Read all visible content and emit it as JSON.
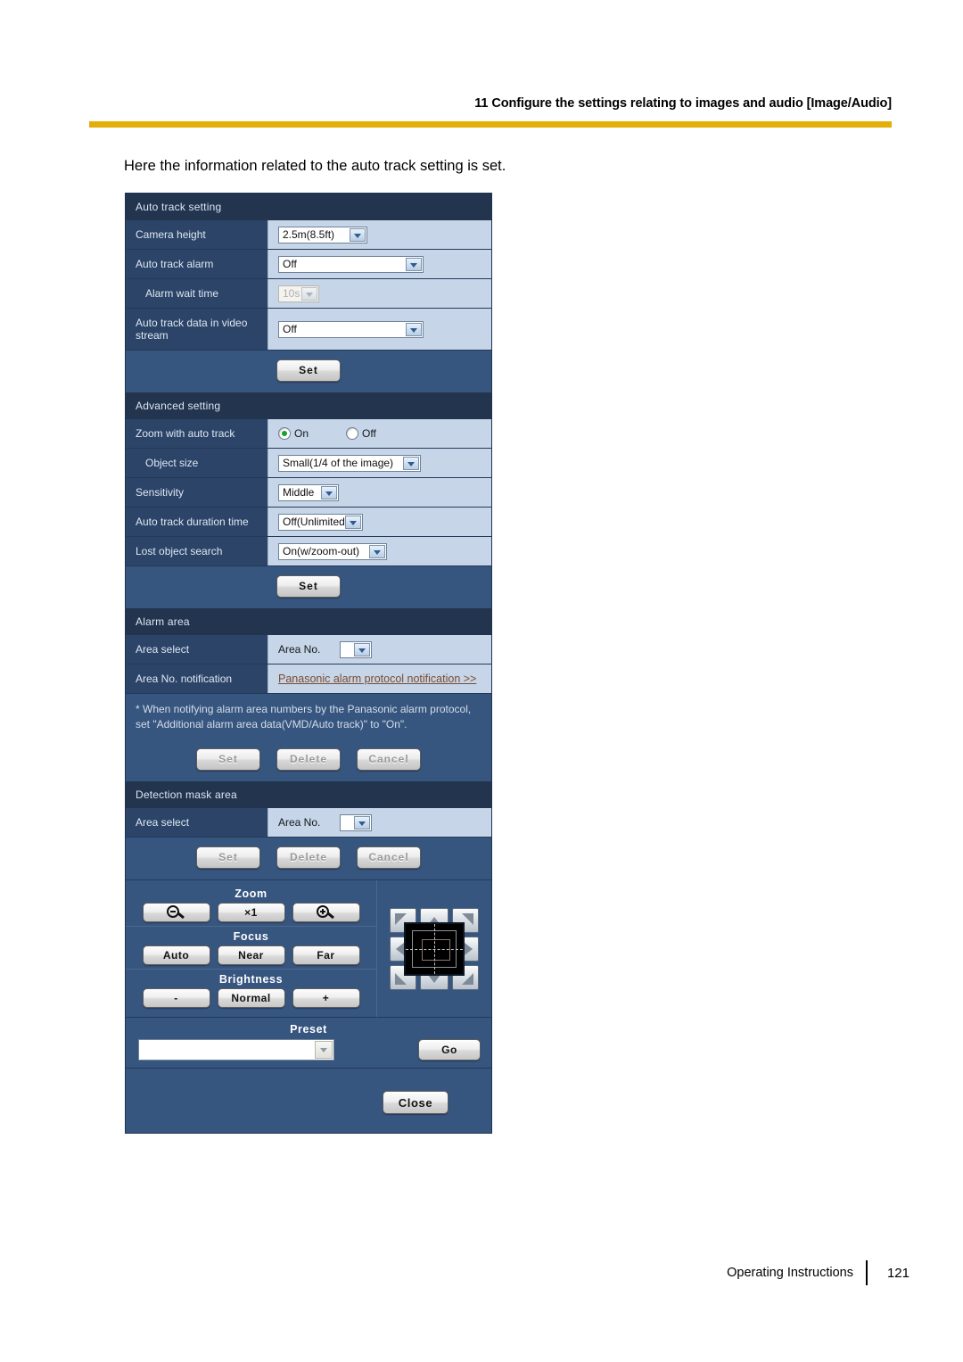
{
  "page": {
    "header_title": "11 Configure the settings relating to images and audio [Image/Audio]",
    "intro_text": "Here the information related to the auto track setting is set.",
    "rule_color": "#e3ae09"
  },
  "footer": {
    "label": "Operating Instructions",
    "page_number": "121"
  },
  "panel": {
    "auto_track_setting": {
      "section_title": "Auto track setting",
      "rows": [
        {
          "label": "Camera height",
          "value": "2.5m(8.5ft)"
        },
        {
          "label": "Auto track alarm",
          "value": "Off"
        },
        {
          "label": "Alarm wait time",
          "value": "10s"
        },
        {
          "label": "Auto track data in video stream",
          "value": "Off"
        }
      ],
      "set_label": "Set"
    },
    "advanced_setting": {
      "section_title": "Advanced setting",
      "zoom_with_auto_track": {
        "label": "Zoom with auto track",
        "on_label": "On",
        "off_label": "Off",
        "selected": "On"
      },
      "rows": [
        {
          "label": "Object size",
          "value": "Small(1/4 of the image)"
        },
        {
          "label": "Sensitivity",
          "value": "Middle"
        },
        {
          "label": "Auto track duration time",
          "value": "Off(Unlimited)"
        },
        {
          "label": "Lost object search",
          "value": "On(w/zoom-out)"
        }
      ],
      "set_label": "Set"
    },
    "alarm_area": {
      "section_title": "Alarm area",
      "area_select_label": "Area select",
      "area_no_label": "Area No.",
      "area_no_value": "",
      "notification_label": "Area No. notification",
      "notification_link": "Panasonic alarm protocol notification >>",
      "note_line1": "* When notifying alarm area numbers by the Panasonic alarm protocol,",
      "note_line2": "set \"Additional alarm area data(VMD/Auto track)\" to \"On\".",
      "buttons": [
        {
          "label": "Set",
          "disabled": true
        },
        {
          "label": "Delete",
          "disabled": true
        },
        {
          "label": "Cancel",
          "disabled": true
        }
      ]
    },
    "detection_mask_area": {
      "section_title": "Detection mask area",
      "area_select_label": "Area select",
      "area_no_label": "Area No.",
      "area_no_value": "",
      "buttons": [
        {
          "label": "Set",
          "disabled": true
        },
        {
          "label": "Delete",
          "disabled": true
        },
        {
          "label": "Cancel",
          "disabled": true
        }
      ]
    },
    "ptz": {
      "zoom": {
        "title": "Zoom",
        "out_icon": "zoom-out-icon",
        "reset_label": "×1",
        "in_icon": "zoom-in-icon"
      },
      "focus": {
        "title": "Focus",
        "auto_label": "Auto",
        "near_label": "Near",
        "far_label": "Far"
      },
      "brightness": {
        "title": "Brightness",
        "minus_label": "-",
        "normal_label": "Normal",
        "plus_label": "+"
      }
    },
    "preset": {
      "title": "Preset",
      "value": "",
      "go_label": "Go"
    },
    "close_label": "Close"
  }
}
